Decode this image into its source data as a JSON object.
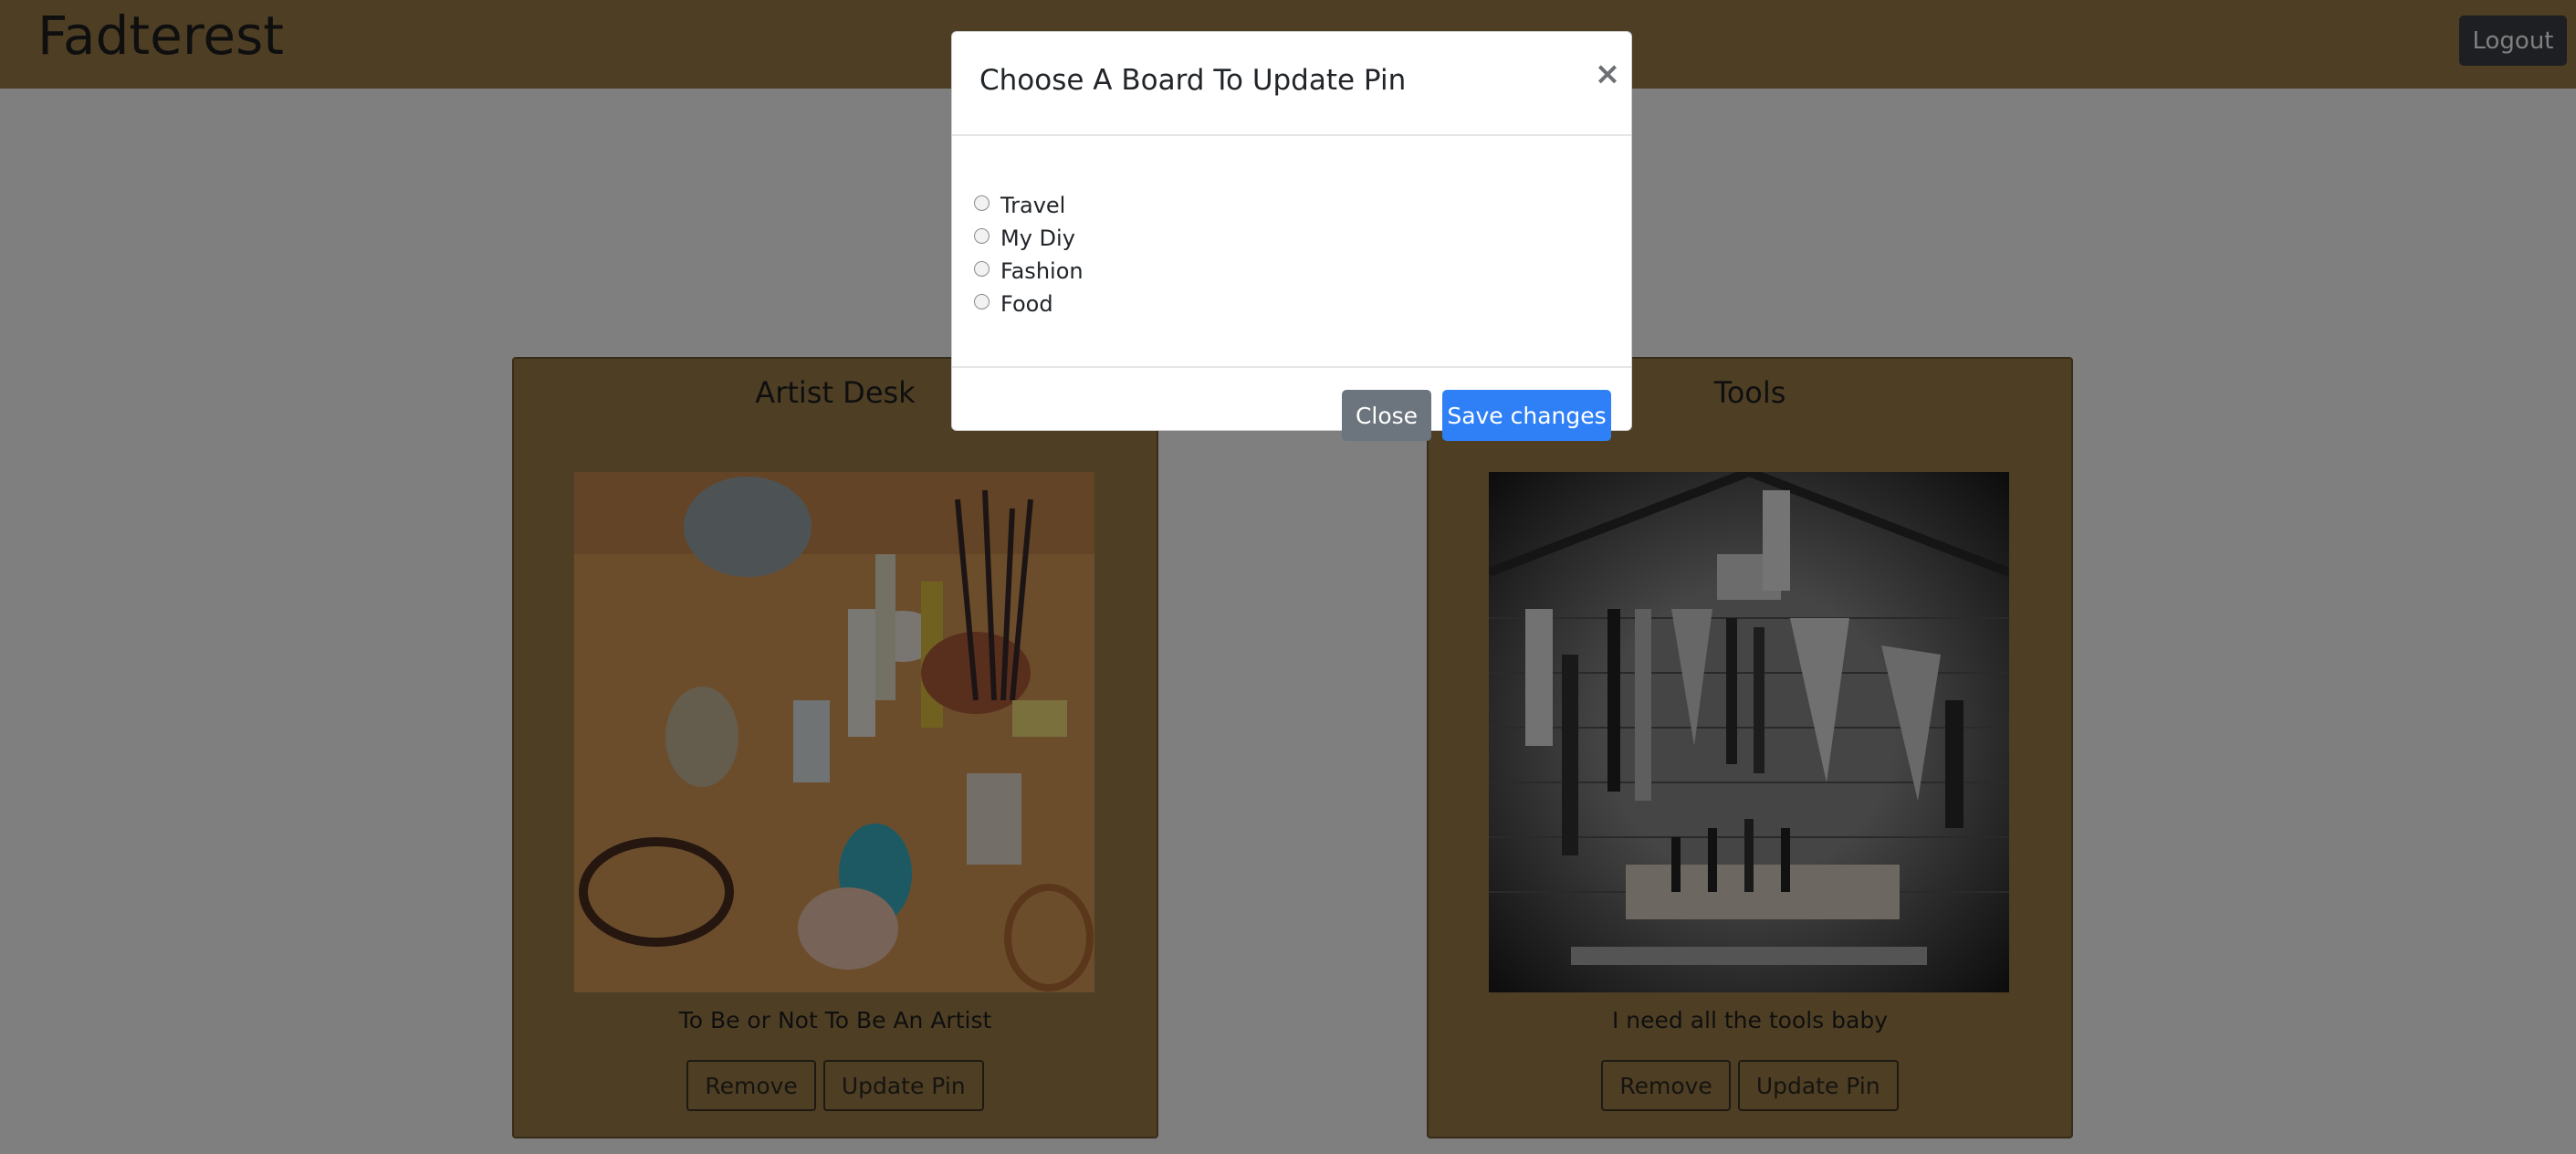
{
  "app": {
    "brand": "Fadterest",
    "logout_label": "Logout"
  },
  "cards": [
    {
      "title": "Artist Desk",
      "caption": "To Be or Not To Be An Artist",
      "remove_label": "Remove",
      "update_label": "Update Pin"
    },
    {
      "title": "Tools",
      "caption": "I need all the tools baby",
      "remove_label": "Remove",
      "update_label": "Update Pin"
    }
  ],
  "modal": {
    "title": "Choose A Board To Update Pin",
    "close_x": "×",
    "options": [
      "Travel",
      "My Diy",
      "Fashion",
      "Food"
    ],
    "close_label": "Close",
    "save_label": "Save changes"
  },
  "colors": {
    "navbar": "#9c7d48",
    "primary": "#2f80f6",
    "secondary": "#6c757d"
  }
}
